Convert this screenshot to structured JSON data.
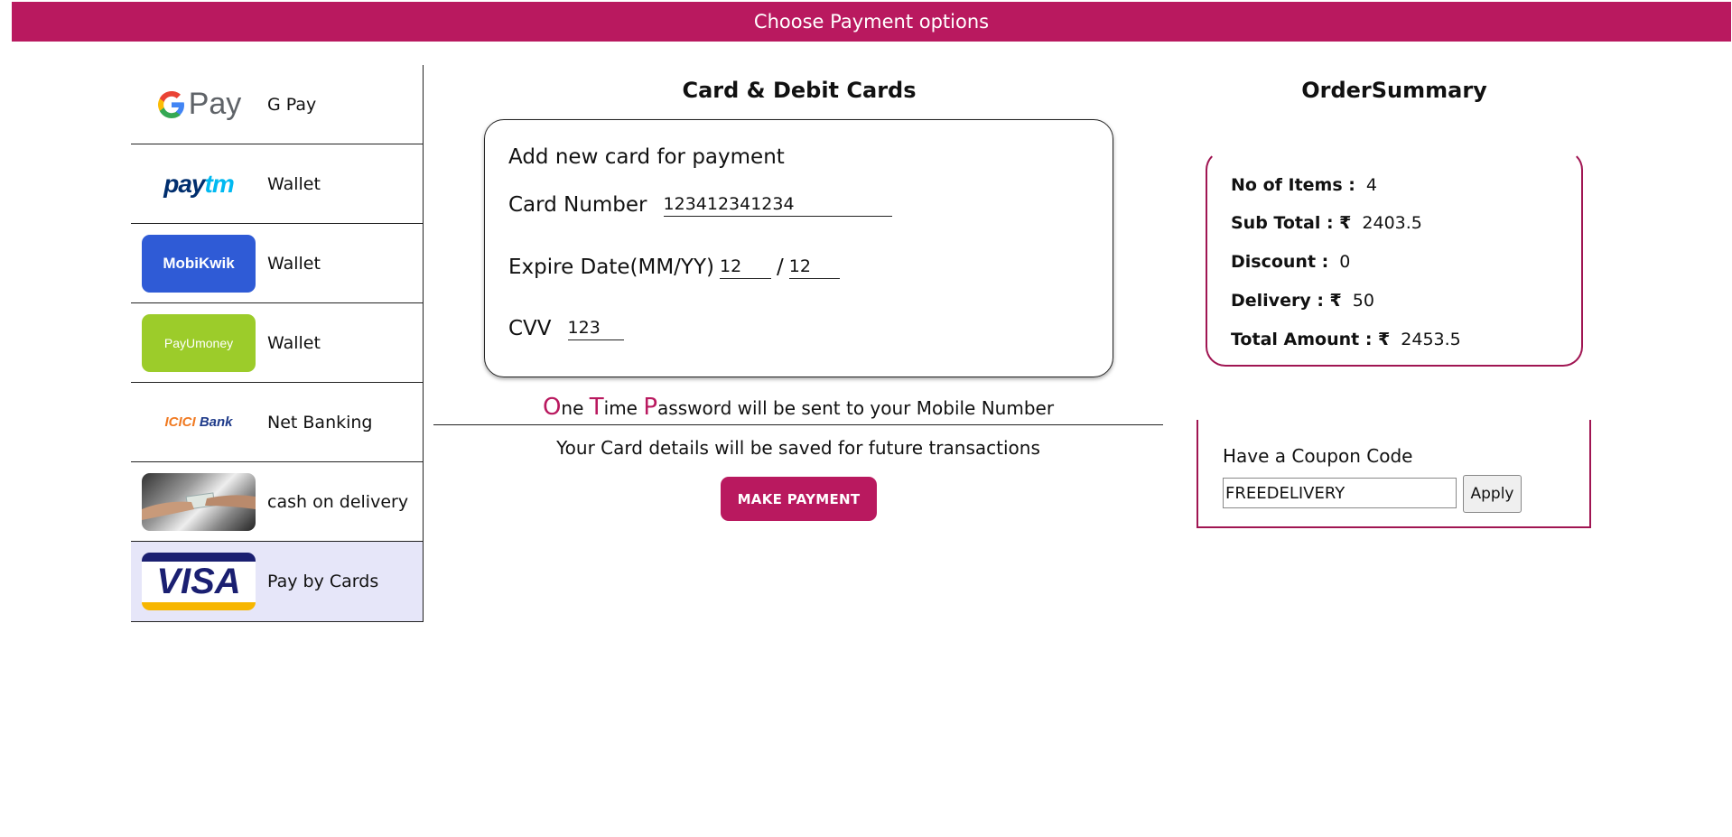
{
  "header": {
    "title": "Choose Payment options"
  },
  "sidebar": {
    "items": [
      {
        "label": "G Pay",
        "logo_text": "Pay",
        "logo": "gpay-logo"
      },
      {
        "label": "Wallet",
        "logo_text": "paytm",
        "logo": "paytm-logo"
      },
      {
        "label": "Wallet",
        "logo_text": "MobiKwik",
        "logo": "mobikwik-logo"
      },
      {
        "label": "Wallet",
        "logo_text": "PayUmoney",
        "logo": "payumoney-logo"
      },
      {
        "label": "Net Banking",
        "logo_text": "ICICI Bank",
        "logo": "icici-logo"
      },
      {
        "label": "cash on delivery",
        "logo_text": "",
        "logo": "cash-handover-image"
      },
      {
        "label": "Pay by Cards",
        "logo_text": "VISA",
        "logo": "visa-logo",
        "selected": true
      }
    ]
  },
  "card_section": {
    "title": "Card & Debit Cards",
    "heading": "Add new card for payment",
    "card_number_label": "Card Number",
    "card_number_value": "123412341234",
    "expire_label": "Expire Date(MM/YY)",
    "expire_month": "12",
    "expire_separator": "/",
    "expire_year": "12",
    "cvv_label": "CVV",
    "cvv_value": "123",
    "otp_O": "O",
    "otp_ne": "ne ",
    "otp_T": "T",
    "otp_ime": "ime ",
    "otp_P": "P",
    "otp_rest": "assword will be sent to your Mobile Number",
    "save_note": "Your Card details will be saved for future transactions",
    "pay_button": "MAKE PAYMENT"
  },
  "order_summary": {
    "title": "OrderSummary",
    "items_label": "No of Items :",
    "items_value": "4",
    "subtotal_label": "Sub Total : ₹",
    "subtotal_value": "2403.5",
    "discount_label": "Discount :",
    "discount_value": "0",
    "delivery_label": "Delivery : ₹",
    "delivery_value": "50",
    "total_label": "Total Amount : ₹",
    "total_value": "2453.5"
  },
  "coupon": {
    "label": "Have a Coupon Code",
    "value": "FREEDELIVERY",
    "apply_button": "Apply"
  },
  "colors": {
    "brand": "#b9195f",
    "border_accent": "#a01552",
    "selected_bg": "#e6e6f9"
  }
}
